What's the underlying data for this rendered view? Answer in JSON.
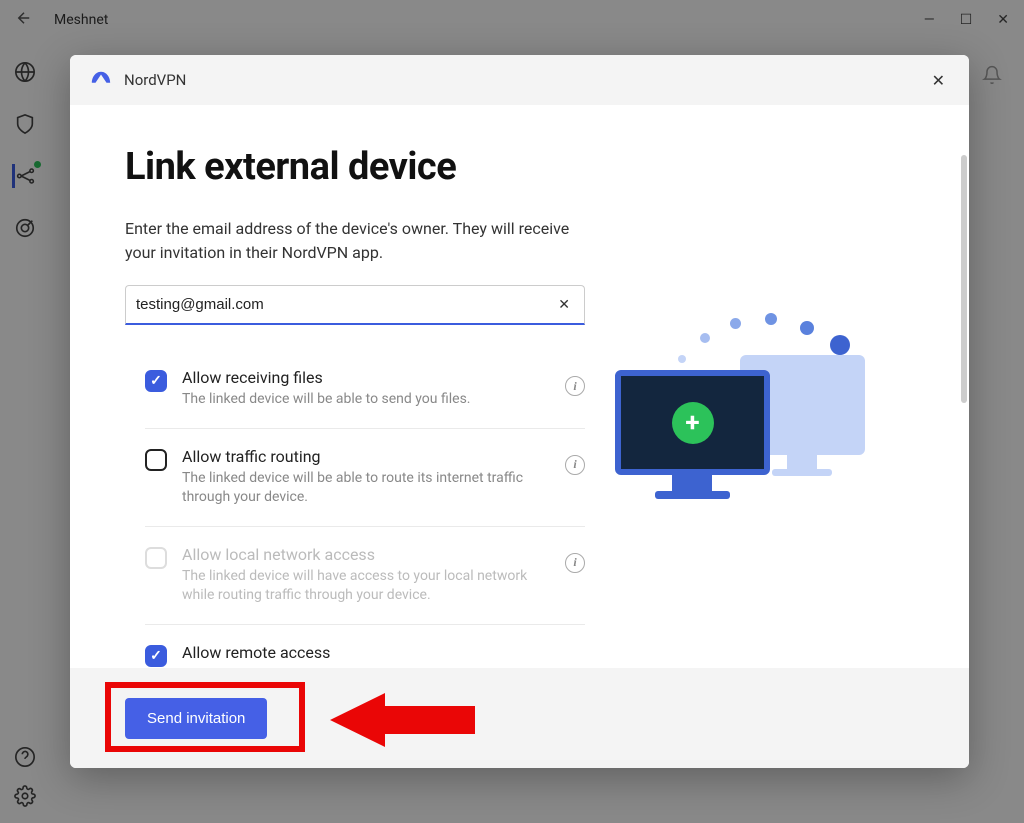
{
  "bg": {
    "title": "Meshnet",
    "win_min": "—",
    "win_max": "☐",
    "win_close": "✕"
  },
  "modal": {
    "app_name": "NordVPN",
    "close": "✕",
    "heading": "Link external device",
    "intro": "Enter the email address of the device's owner. They will receive your invitation in their NordVPN app.",
    "email_value": "testing@gmail.com",
    "email_clear": "✕",
    "options": {
      "files_title": "Allow receiving files",
      "files_desc": "The linked device will be able to send you files.",
      "routing_title": "Allow traffic routing",
      "routing_desc": "The linked device will be able to route its internet traffic through your device.",
      "lan_title": "Allow local network access",
      "lan_desc": "The linked device will have access to your local network while routing traffic through your device.",
      "remote_title": "Allow remote access",
      "info": "i"
    },
    "send_label": "Send invitation"
  }
}
